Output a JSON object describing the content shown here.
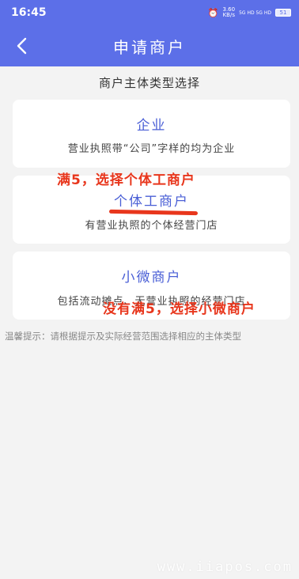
{
  "status_bar": {
    "time": "16:45",
    "speed_value": "3.60",
    "speed_unit": "KB/s",
    "network": "5G HD 5G HD",
    "battery": "51"
  },
  "header": {
    "title": "申请商户",
    "back_icon": "chevron-left-icon"
  },
  "section_title": "商户主体类型选择",
  "cards": [
    {
      "name": "企业",
      "desc": "营业执照带“公司”字样的均为企业"
    },
    {
      "name": "个体工商户",
      "desc": "有营业执照的个体经营门店"
    },
    {
      "name": "小微商户",
      "desc": "包括流动摊点、无营业执照的经营门店"
    }
  ],
  "tip": "温馨提示：请根据提示及实际经营范围选择相应的主体类型",
  "annotations": {
    "note1": "满5，选择个体工商户",
    "note2": "没有满5，选择小微商户"
  },
  "watermark": "www.iiapos.com",
  "colors": {
    "primary": "#5c6fe8",
    "card_title": "#4a5fd6",
    "annotation": "#e8361c",
    "background": "#f3f3f3"
  }
}
